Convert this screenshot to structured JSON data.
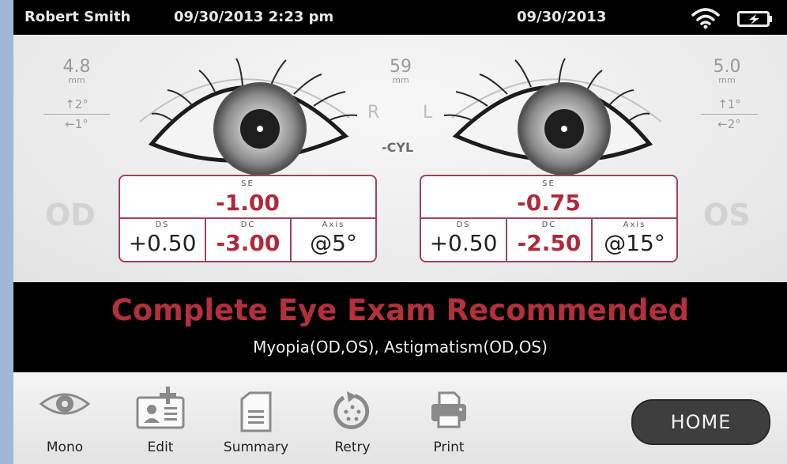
{
  "status": {
    "user": "Robert Smith",
    "datetime": "09/30/2013 2:23 pm",
    "date": "09/30/2013"
  },
  "measurements": {
    "od_pupil": "4.8",
    "os_pupil": "5.0",
    "pd": "59",
    "unit": "mm",
    "od_vertical": "↑2°",
    "od_horizontal": "←1°",
    "os_vertical": "↑1°",
    "os_horizontal": "←2°",
    "r_label": "R",
    "l_label": "L",
    "cyl": "-CYL"
  },
  "od": {
    "side": "OD",
    "se_label": "SE",
    "se": "-1.00",
    "ds_label": "DS",
    "ds": "+0.50",
    "dc_label": "DC",
    "dc": "-3.00",
    "axis_label": "Axis",
    "axis": "@5°"
  },
  "os": {
    "side": "OS",
    "se_label": "SE",
    "se": "-0.75",
    "ds_label": "DS",
    "ds": "+0.50",
    "dc_label": "DC",
    "dc": "-2.50",
    "axis_label": "Axis",
    "axis": "@15°"
  },
  "banner": {
    "title": "Complete Eye Exam Recommended",
    "subtitle": "Myopia(OD,OS), Astigmatism(OD,OS)"
  },
  "toolbar": {
    "mono": "Mono",
    "edit": "Edit",
    "summary": "Summary",
    "retry": "Retry",
    "print": "Print",
    "home": "HOME"
  },
  "colors": {
    "accent": "#b0283c",
    "box_border": "#a0435a",
    "banner_bg": "#000000",
    "home_bg": "#3e3e3e"
  },
  "icons": [
    "wifi-icon",
    "battery-icon",
    "eye-icon",
    "edit-icon",
    "summary-icon",
    "retry-icon",
    "print-icon"
  ]
}
